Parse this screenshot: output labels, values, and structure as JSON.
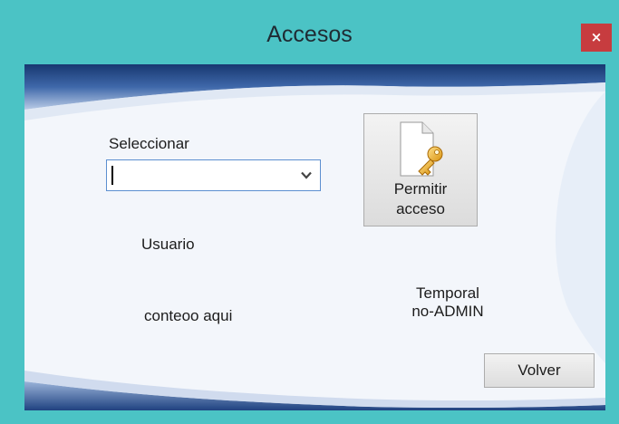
{
  "window": {
    "title": "Accesos",
    "close_glyph": "×"
  },
  "form": {
    "select_label": "Seleccionar",
    "combo_value": "",
    "usuario_label": "Usuario",
    "conteo_label": "conteoo aqui",
    "temporal_line1": "Temporal",
    "temporal_line2": "no-ADMIN"
  },
  "buttons": {
    "permitir_line1": "Permitir",
    "permitir_line2": "acceso",
    "permitir_icon": "document-key-icon",
    "volver": "Volver"
  },
  "colors": {
    "titlebar": "#4bc3c5",
    "close_button": "#c73c3f",
    "wave_dark": "#1e3f7a",
    "client_bg": "#f3f6fb"
  }
}
